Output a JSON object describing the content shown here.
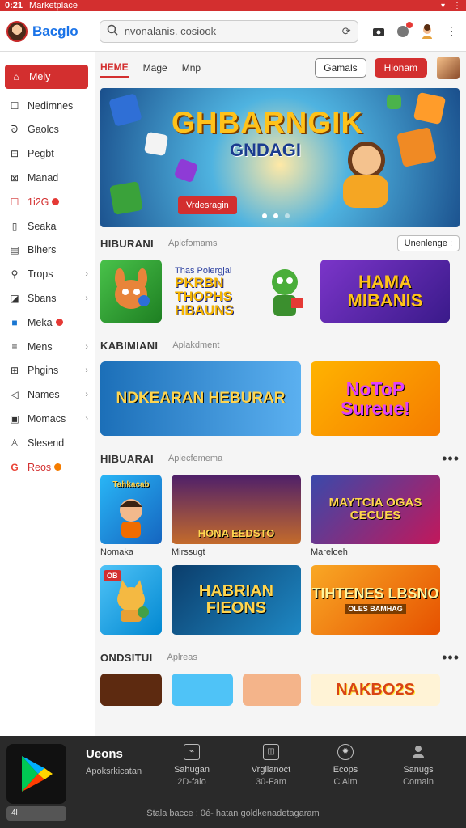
{
  "status": {
    "time": "0:21",
    "app": "Marketplace"
  },
  "topbar": {
    "logo_text": "Bacglo",
    "search_value": "nvonalanis. cosiook"
  },
  "sidebar": {
    "items": [
      {
        "label": "Mely",
        "icon": "home-icon",
        "active": true
      },
      {
        "label": "Nedimnes",
        "icon": "square-icon"
      },
      {
        "label": "Gaolcs",
        "icon": "swirl-icon"
      },
      {
        "label": "Pegbt",
        "icon": "window-icon"
      },
      {
        "label": "Manad",
        "icon": "image-icon"
      },
      {
        "label": "1i2G",
        "icon": "red-square-icon",
        "red": true,
        "dot": "red"
      },
      {
        "label": "Seaka",
        "icon": "phone-icon"
      },
      {
        "label": "Blhers",
        "icon": "book-icon"
      },
      {
        "label": "Trops",
        "icon": "pin-icon",
        "chevron": true
      },
      {
        "label": "Sbans",
        "icon": "tag-icon",
        "chevron": true
      },
      {
        "label": "Meka",
        "icon": "blue-square-icon",
        "dot": "red"
      },
      {
        "label": "Mens",
        "icon": "list-icon",
        "chevron": true
      },
      {
        "label": "Phgins",
        "icon": "grid-icon",
        "chevron": true
      },
      {
        "label": "Names",
        "icon": "back-arrow-icon",
        "chevron": true
      },
      {
        "label": "Momacs",
        "icon": "box-icon",
        "chevron": true
      },
      {
        "label": "Slesend",
        "icon": "person-icon"
      },
      {
        "label": "Reos",
        "icon": "google-icon",
        "red": true,
        "dot": "orange"
      }
    ]
  },
  "tabs": [
    "HEME",
    "Mage",
    "Mnp"
  ],
  "header_buttons": {
    "outline": "Gamals",
    "red": "Hionam"
  },
  "banner": {
    "title": "GHBARNGIK",
    "subtitle": "GNDAGI",
    "button": "Vrdesragin"
  },
  "sections": [
    {
      "title": "HIBURANI",
      "sub": "Aplcfomams",
      "right": "Unenlenge :"
    },
    {
      "title": "KABIMIANI",
      "sub": "Aplakdment"
    },
    {
      "title": "HIBUARAI",
      "sub": "Aplecfemema",
      "right": "•••"
    },
    {
      "title": "ONDSITUI",
      "sub": "Aplreas",
      "right": "•••"
    }
  ],
  "row1": {
    "card2_text": "Thas Polergjal",
    "card2_big": "PKRBN THOPHS HBAUNS",
    "card3": "HAMA MIBANIS"
  },
  "row2": {
    "card1": "NDKEARAN HEBURAR",
    "card2": "NoToP Sureue!"
  },
  "row3": {
    "card1": "Tahkacab",
    "card3": "MAYTCIA OGAS CECUES",
    "card2": "HONA EEDSTO",
    "captions": [
      "Nomaka",
      "Mirssugt",
      "Mareloeh"
    ]
  },
  "row4": {
    "card1_tag": "OB",
    "card2": "HABRIAN FIEONS",
    "card3": "TIHTENES LBSNO",
    "card3_sub": "OLES BAMHAG"
  },
  "row5": {
    "card4": "NAKBO2S"
  },
  "bottom": {
    "title": "Ueons",
    "subtitle": "Apoksrkicatan",
    "small": "4l",
    "nav": [
      {
        "label": "Sahugan",
        "label2": "2D-falo",
        "icon": "screen-icon"
      },
      {
        "label": "Vrglianoct",
        "label2": "30-Fam",
        "icon": "window-icon"
      },
      {
        "label": "Ecops",
        "label2": "C Aim",
        "icon": "gear-icon"
      },
      {
        "label": "Sanugs",
        "label2": "Comain",
        "icon": "person-icon"
      }
    ],
    "footer": "Stala bacce : 0é- hatan goldkenadetagaram"
  }
}
